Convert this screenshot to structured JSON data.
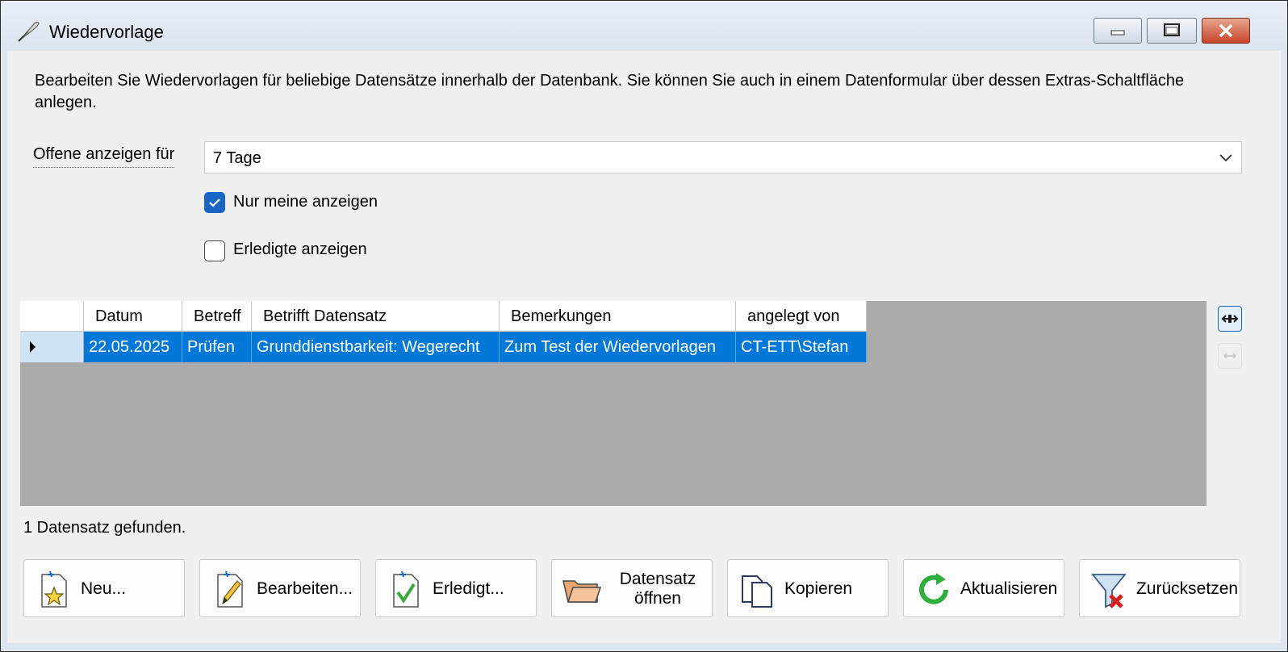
{
  "window": {
    "title": "Wiedervorlage"
  },
  "description": "Bearbeiten Sie Wiedervorlagen für beliebige Datensätze innerhalb der Datenbank. Sie können Sie auch in einem Datenformular über dessen Extras-Schaltfläche anlegen.",
  "filter": {
    "label": "Offene anzeigen für",
    "selected": "7 Tage",
    "only_mine_label": "Nur meine anzeigen",
    "only_mine_checked": true,
    "done_label": "Erledigte anzeigen",
    "done_checked": false
  },
  "grid": {
    "columns": [
      "Datum",
      "Betreff",
      "Betrifft Datensatz",
      "Bemerkungen",
      "angelegt von"
    ],
    "rows": [
      [
        "22.05.2025",
        "Prüfen",
        "Grunddienstbarkeit: Wegerecht",
        "Zum Test der Wiedervorlagen",
        "CT-ETT\\Stefan"
      ]
    ]
  },
  "status": "1 Datensatz gefunden.",
  "buttons": {
    "new": "Neu...",
    "edit": "Bearbeiten...",
    "done": "Erledigt...",
    "open_record_line1": "Datensatz",
    "open_record_line2": "öffnen",
    "copy": "Kopieren",
    "refresh": "Aktualisieren",
    "reset": "Zurücksetzen"
  },
  "colors": {
    "selection": "#0078d7",
    "grid_background": "#ababab",
    "accent": "#1b66c5"
  }
}
